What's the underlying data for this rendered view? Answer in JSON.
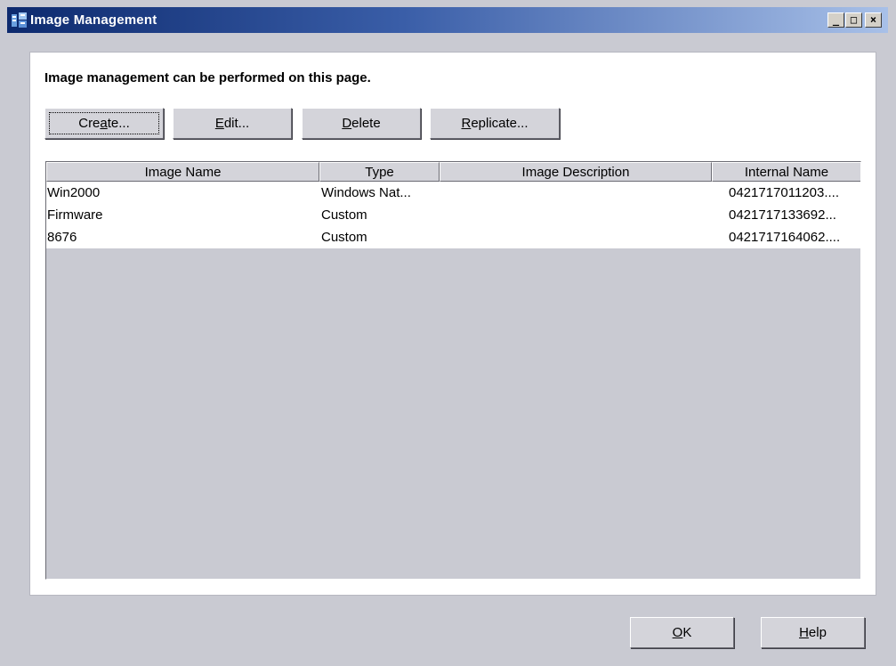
{
  "window": {
    "title": "Image Management",
    "minimize_glyph": "_",
    "maximize_glyph": "□",
    "close_glyph": "×"
  },
  "page": {
    "description": "Image management can be performed on this page."
  },
  "toolbar": {
    "create": {
      "pre": "Cre",
      "mnemonic": "a",
      "post": "te..."
    },
    "edit": {
      "pre": "",
      "mnemonic": "E",
      "post": "dit..."
    },
    "delete": {
      "pre": "",
      "mnemonic": "D",
      "post": "elete"
    },
    "replicate": {
      "pre": "",
      "mnemonic": "R",
      "post": "eplicate..."
    }
  },
  "table": {
    "columns": [
      "Image Name",
      "Type",
      "Image Description",
      "Internal Name"
    ],
    "rows": [
      [
        "Win2000",
        "Windows Nat...",
        "",
        "0421717011203...."
      ],
      [
        "Firmware",
        "Custom",
        "",
        "0421717133692..."
      ],
      [
        "8676",
        "Custom",
        "",
        "0421717164062...."
      ]
    ]
  },
  "footer": {
    "ok": {
      "pre": "",
      "mnemonic": "O",
      "post": "K"
    },
    "help": {
      "pre": "",
      "mnemonic": "H",
      "post": "elp"
    }
  },
  "colors": {
    "titlebar_start": "#0d2a6e",
    "titlebar_end": "#a8c0e8",
    "background": "#c9cad2",
    "panel": "#ffffff"
  },
  "icons": {
    "app": "app-icon",
    "minimize": "minimize-icon",
    "maximize": "maximize-icon",
    "close": "close-icon"
  }
}
